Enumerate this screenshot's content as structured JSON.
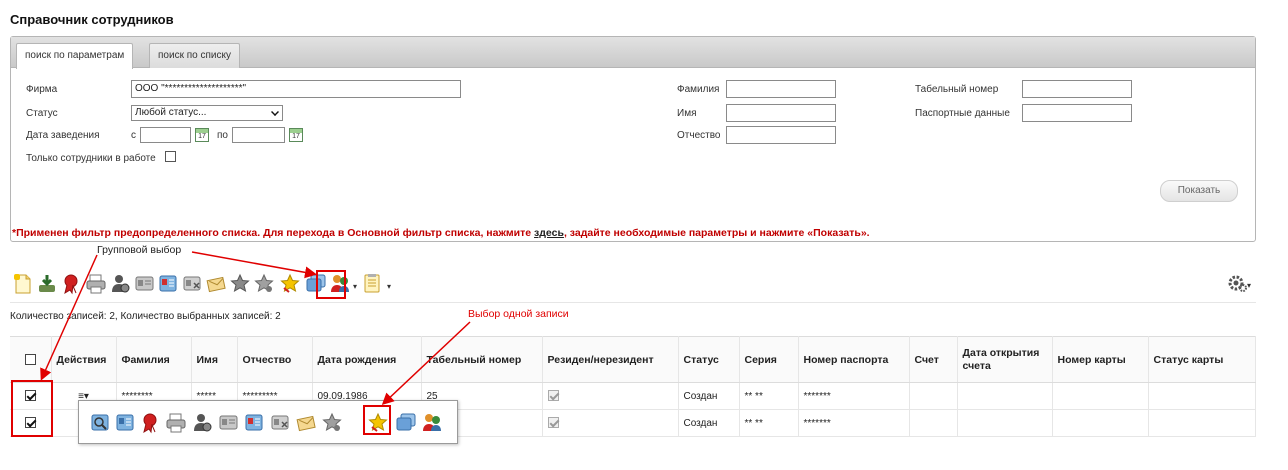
{
  "page_title": "Справочник сотрудников",
  "tabs": [
    {
      "label": "поиск по параметрам",
      "active": true
    },
    {
      "label": "поиск по списку",
      "active": false
    }
  ],
  "filters": {
    "firm_label": "Фирма",
    "firm_value": "ООО \"********************\"",
    "status_label": "Статус",
    "status_value": "Любой статус...",
    "date_label": "Дата заведения",
    "date_from_label": "с",
    "date_to_label": "по",
    "date_from_value": "",
    "date_to_value": "",
    "calendar_glyph": "17",
    "only_working_label": "Только сотрудники в работе",
    "surname_label": "Фамилия",
    "name_label": "Имя",
    "patronymic_label": "Отчество",
    "tab_number_label": "Табельный номер",
    "passport_label": "Паспортные данные",
    "show_button": "Показать"
  },
  "notice": {
    "before": "*Применен фильтр предопределенного списка. Для перехода в Основной фильтр списка, нажмите ",
    "link": "здесь",
    "after": ", задайте необходимые параметры и нажмите «Показать».",
    "color": "#c00000"
  },
  "callouts": {
    "group_select": "Групповой выбор",
    "single_select": "Выбор одной записи",
    "color": "#e00000"
  },
  "toolbar_icons": [
    "new-document-icon",
    "download-icon",
    "ribbon-award-icon",
    "printer-icon",
    "user-gear-icon",
    "id-card-icon",
    "id-card-red-icon",
    "card-delete-icon",
    "envelope-pen-icon",
    "star-icon",
    "star-grey-icon",
    "star-highlight-icon",
    "copy-cards-icon",
    "users-icon",
    "document-list-icon",
    "settings-gear-icon"
  ],
  "records_info": "Количество записей: 2, Количество выбранных записей: 2",
  "table": {
    "headers": [
      "",
      "Действия",
      "Фамилия",
      "Имя",
      "Отчество",
      "Дата рождения",
      "Табельный номер",
      "Резиден/нерезидент",
      "Статус",
      "Серия",
      "Номер паспорта",
      "Счет",
      "Дата открытия счета",
      "Номер карты",
      "Статус карты"
    ],
    "rows": [
      {
        "surname": "********",
        "name": "*****",
        "patronymic": "*********",
        "birth": "09.09.1986",
        "tab": "25",
        "status": "Создан",
        "series": "** **",
        "passport": "*******"
      },
      {
        "surname": "",
        "name": "",
        "patronymic": "",
        "birth": "",
        "tab": "",
        "status": "Создан",
        "series": "** **",
        "passport": "*******"
      }
    ]
  },
  "actions_glyph": "≡▾"
}
